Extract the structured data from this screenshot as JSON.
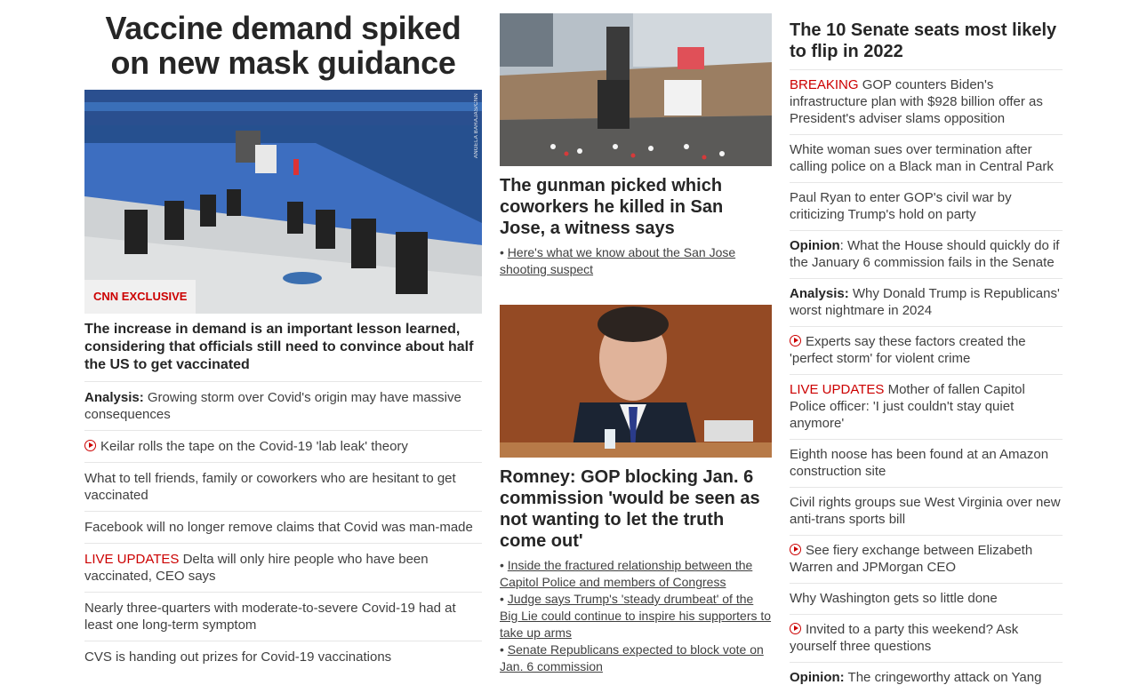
{
  "left": {
    "headline": "Vaccine demand spiked on new mask guidance",
    "image_credit": "ANGELA BARAJAS/CNN",
    "tag": "CNN EXCLUSIVE",
    "summary": "The increase in demand is an important lesson learned, considering that officials still need to convince about half the US to get vaccinated",
    "links": [
      {
        "prefix": "Analysis:",
        "prefix_style": "bold",
        "text": " Growing storm over Covid's origin may have massive consequences",
        "video": false
      },
      {
        "prefix": "",
        "prefix_style": "",
        "text": "Keilar rolls the tape on the Covid-19 'lab leak' theory",
        "video": true
      },
      {
        "prefix": "",
        "prefix_style": "",
        "text": "What to tell friends, family or coworkers who are hesitant to get vaccinated",
        "video": false
      },
      {
        "prefix": "",
        "prefix_style": "",
        "text": "Facebook will no longer remove claims that Covid was man-made",
        "video": false
      },
      {
        "prefix": "LIVE UPDATES",
        "prefix_style": "red",
        "text": " Delta will only hire people who have been vaccinated, CEO says",
        "video": false
      },
      {
        "prefix": "",
        "prefix_style": "",
        "text": "Nearly three-quarters with moderate-to-severe Covid-19 had at least one long-term symptom",
        "video": false
      },
      {
        "prefix": "",
        "prefix_style": "",
        "text": "CVS is handing out prizes for Covid-19 vaccinations",
        "video": false
      }
    ]
  },
  "middle": {
    "story1": {
      "headline": "The gunman picked which coworkers he killed in San Jose, a witness says",
      "bullets": [
        "Here's what we know about the San Jose shooting suspect"
      ]
    },
    "story2": {
      "headline": "Romney: GOP blocking Jan. 6 commission 'would be seen as not wanting to let the truth come out'",
      "bullets": [
        "Inside the fractured relationship between the Capitol Police and members of Congress",
        "Judge says Trump's 'steady drumbeat' of the Big Lie could continue to inspire his supporters to take up arms",
        "Senate Republicans expected to block vote on Jan. 6 commission"
      ]
    }
  },
  "right": {
    "title": "The 10 Senate seats most likely to flip in 2022",
    "links": [
      {
        "prefix": "BREAKING",
        "prefix_style": "red",
        "text": " GOP counters Biden's infrastructure plan with $928 billion offer as President's adviser slams opposition",
        "video": false
      },
      {
        "prefix": "",
        "prefix_style": "",
        "text": "White woman sues over termination after calling police on a Black man in Central Park",
        "video": false
      },
      {
        "prefix": "",
        "prefix_style": "",
        "text": "Paul Ryan to enter GOP's civil war by criticizing Trump's hold on party",
        "video": false
      },
      {
        "prefix": "Opinion",
        "prefix_style": "bold",
        "text": ": What the House should quickly do if the January 6 commission fails in the Senate",
        "video": false
      },
      {
        "prefix": "Analysis:",
        "prefix_style": "bold",
        "text": " Why Donald Trump is Republicans' worst nightmare in 2024",
        "video": false
      },
      {
        "prefix": "",
        "prefix_style": "",
        "text": "Experts say these factors created the 'perfect storm' for violent crime",
        "video": true
      },
      {
        "prefix": "LIVE UPDATES",
        "prefix_style": "red",
        "text": " Mother of fallen Capitol Police officer: 'I just couldn't stay quiet anymore'",
        "video": false
      },
      {
        "prefix": "",
        "prefix_style": "",
        "text": "Eighth noose has been found at an Amazon construction site",
        "video": false
      },
      {
        "prefix": "",
        "prefix_style": "",
        "text": "Civil rights groups sue West Virginia over new anti-trans sports bill",
        "video": false
      },
      {
        "prefix": "",
        "prefix_style": "",
        "text": "See fiery exchange between Elizabeth Warren and JPMorgan CEO",
        "video": true
      },
      {
        "prefix": "",
        "prefix_style": "",
        "text": "Why Washington gets so little done",
        "video": false
      },
      {
        "prefix": "",
        "prefix_style": "",
        "text": "Invited to a party this weekend? Ask yourself three questions",
        "video": true
      },
      {
        "prefix": "Opinion:",
        "prefix_style": "bold",
        "text": " The cringeworthy attack on Yang",
        "video": false
      }
    ]
  },
  "colors": {
    "accent_red": "#cc0000",
    "text": "#262626",
    "divider": "#e6e6e6"
  }
}
